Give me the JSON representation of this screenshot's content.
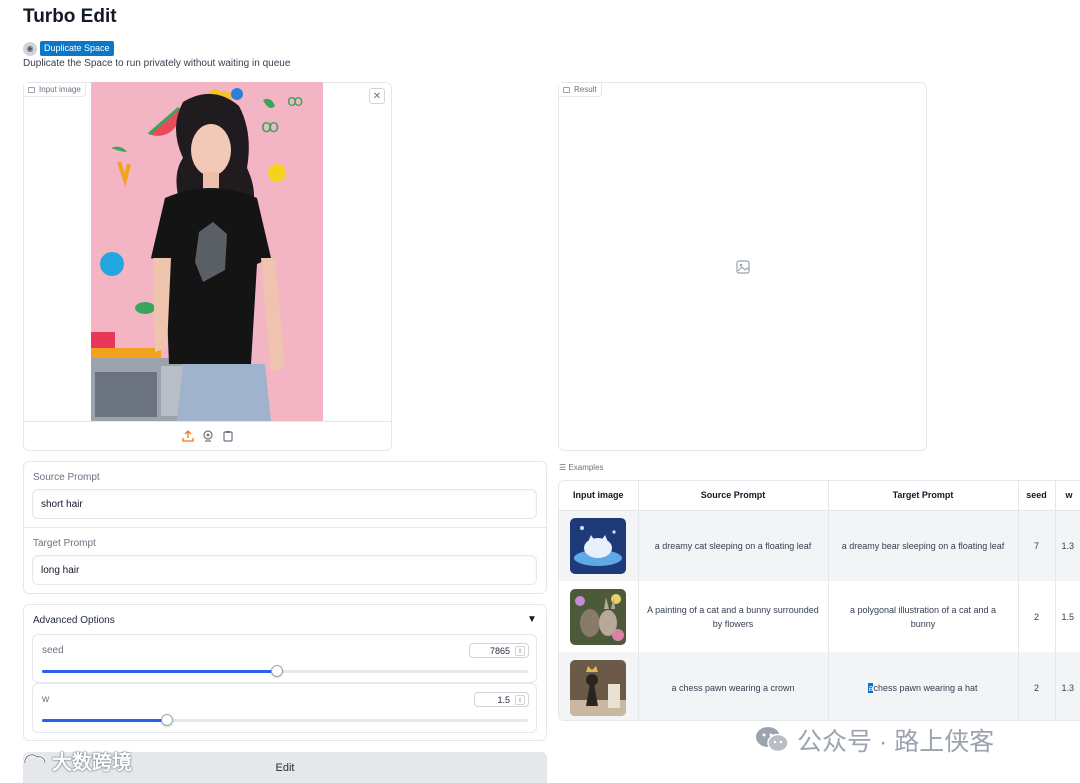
{
  "app": {
    "title": "Turbo Edit",
    "duplicate_label": "Duplicate Space",
    "duplicate_note": "Duplicate the Space to run privately without waiting in queue"
  },
  "input_image": {
    "label": "Input image",
    "clear_icon": "close-icon",
    "toolbar_icons": [
      "upload-icon",
      "webcam-icon",
      "clipboard-icon"
    ]
  },
  "result": {
    "label": "Result",
    "placeholder_icon": "image-icon"
  },
  "prompts": {
    "source_label": "Source Prompt",
    "source_value": "short hair",
    "target_label": "Target Prompt",
    "target_value": "long hair"
  },
  "advanced": {
    "title": "Advanced Options",
    "toggle": "▼",
    "seed": {
      "label": "seed",
      "value": "7865",
      "fraction": 0.484
    },
    "w": {
      "label": "w",
      "value": "1.5",
      "fraction": 0.258
    }
  },
  "edit_button": "Edit",
  "examples": {
    "label": "Examples",
    "columns": [
      "Input image",
      "Source Prompt",
      "Target Prompt",
      "seed",
      "w"
    ],
    "rows": [
      {
        "image": "cat-on-leaf",
        "source": "a dreamy cat sleeping on a floating leaf",
        "target": "a dreamy bear sleeping on a floating leaf",
        "seed": "7",
        "w": "1.3"
      },
      {
        "image": "cat-bunny-flowers",
        "source": "A painting of a cat and a bunny surrounded by flowers",
        "target": "a polygonal illustration of a cat and a bunny",
        "seed": "2",
        "w": "1.5"
      },
      {
        "image": "chess-pawn",
        "source": "a chess pawn wearing a crown",
        "target_highlight": "a",
        "target_rest": "chess pawn wearing a hat",
        "seed": "2",
        "w": "1.3"
      }
    ]
  },
  "watermarks": {
    "right": "公众号 · 路上侠客",
    "left": "大数跨境"
  }
}
